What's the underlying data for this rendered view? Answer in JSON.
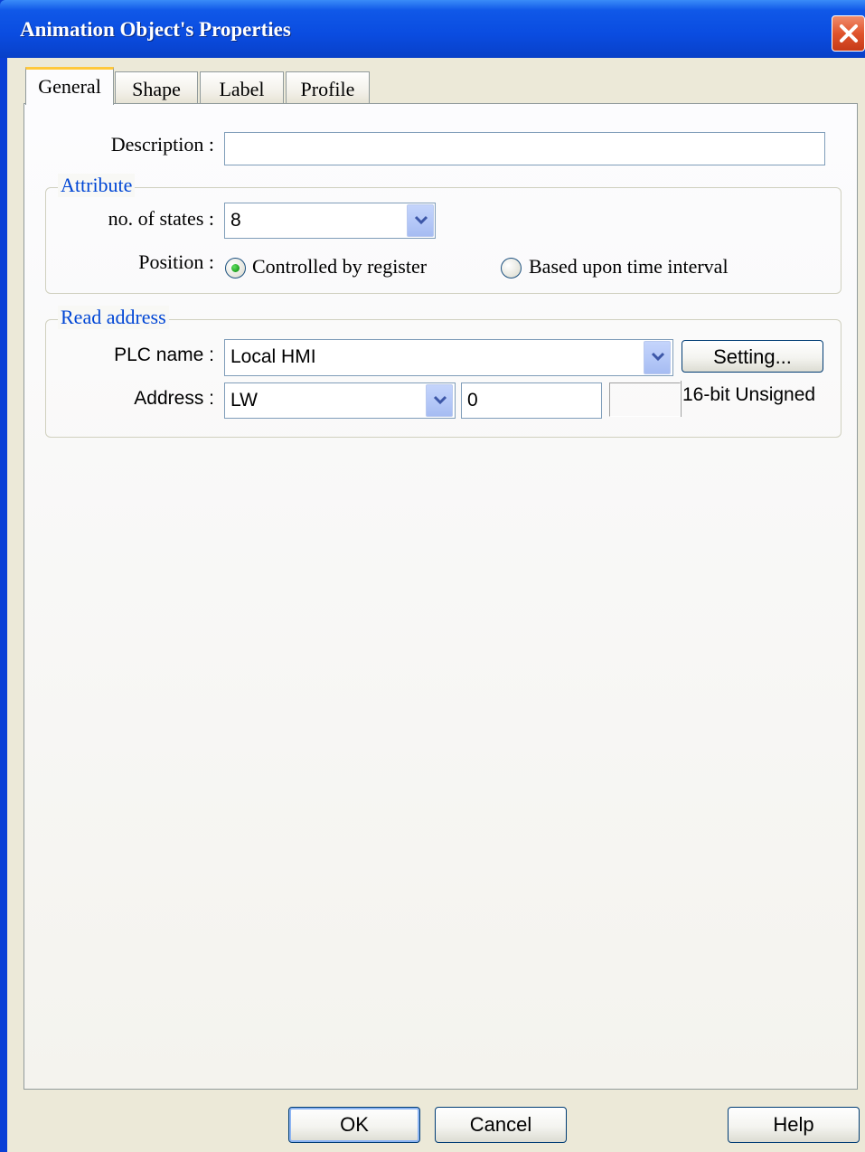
{
  "window": {
    "title": "Animation Object's Properties"
  },
  "tabs": [
    {
      "label": "General",
      "active": true
    },
    {
      "label": "Shape",
      "active": false
    },
    {
      "label": "Label",
      "active": false
    },
    {
      "label": "Profile",
      "active": false
    }
  ],
  "general": {
    "description_label": "Description :",
    "description_value": "",
    "attribute": {
      "title": "Attribute",
      "states_label": "no. of states :",
      "states_value": "8",
      "position_label": "Position :",
      "position_options": [
        {
          "label": "Controlled by register",
          "selected": true
        },
        {
          "label": "Based upon time interval",
          "selected": false
        }
      ]
    },
    "read_address": {
      "title": "Read address",
      "plc_label": "PLC name :",
      "plc_value": "Local HMI",
      "setting_button": "Setting...",
      "address_label": "Address :",
      "address_device": "LW",
      "address_value": "0",
      "address_format": "16-bit Unsigned"
    }
  },
  "buttons": {
    "ok": "OK",
    "cancel": "Cancel",
    "help": "Help"
  },
  "colors": {
    "titlebar": "#0a4ce0",
    "group_title": "#0046d5",
    "close_button": "#e0542c",
    "active_tab_accent": "#ffc83c"
  },
  "icons": {
    "close": "close-icon",
    "dropdown": "chevron-down-icon"
  }
}
